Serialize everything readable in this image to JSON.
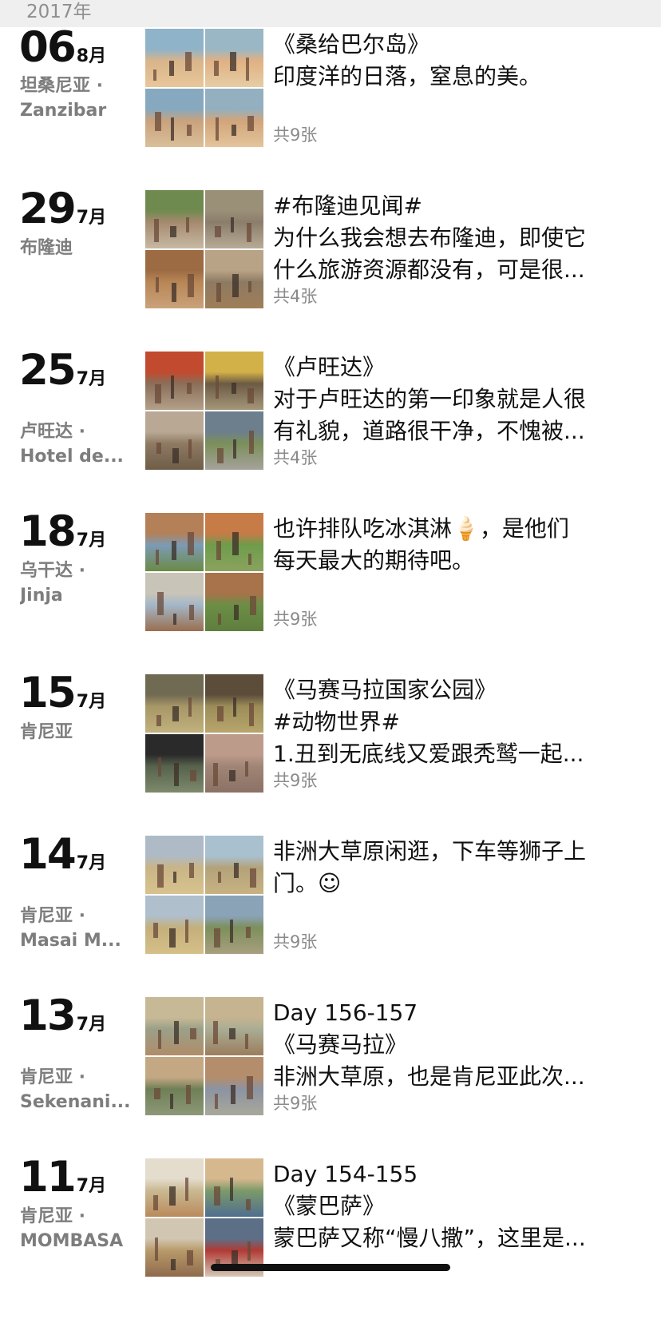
{
  "year_header": "2017年",
  "photo_count_label": "共{n}张",
  "entries": [
    {
      "day": "06",
      "month": "8月",
      "location": [
        "坦桑尼亚 ·",
        "Zanzibar"
      ],
      "lines": [
        "《桑给巴尔岛》",
        "印度洋的日落，窒息的美。"
      ],
      "count": "共9张"
    },
    {
      "day": "29",
      "month": "7月",
      "location": [
        "布隆迪"
      ],
      "lines": [
        "#布隆迪见闻#",
        "为什么我会想去布隆迪，即使它",
        "什么旅游资源都没有，可是很..."
      ],
      "count": "共4张"
    },
    {
      "day": "25",
      "month": "7月",
      "location": [
        "卢旺达 ·",
        "Hotel de..."
      ],
      "lines": [
        "《卢旺达》",
        "对于卢旺达的第一印象就是人很",
        "有礼貌，道路很干净，不愧被..."
      ],
      "count": "共4张"
    },
    {
      "day": "18",
      "month": "7月",
      "location": [
        "乌干达 ·",
        "Jinja"
      ],
      "lines": [
        "也许排队吃冰淇淋🍦，是他们",
        "每天最大的期待吧。"
      ],
      "count": "共9张"
    },
    {
      "day": "15",
      "month": "7月",
      "location": [
        "肯尼亚"
      ],
      "lines": [
        "《马赛马拉国家公园》",
        "#动物世界#",
        "1.丑到无底线又爱跟秃鹫一起..."
      ],
      "count": "共9张"
    },
    {
      "day": "14",
      "month": "7月",
      "location": [
        "肯尼亚 ·",
        "Masai M..."
      ],
      "lines": [
        "非洲大草原闲逛，下车等狮子上",
        "门。☺"
      ],
      "count": "共9张"
    },
    {
      "day": "13",
      "month": "7月",
      "location": [
        "肯尼亚 ·",
        "Sekenani..."
      ],
      "lines": [
        "Day 156-157",
        "《马赛马拉》",
        "非洲大草原，也是肯尼亚此次..."
      ],
      "count": "共9张"
    },
    {
      "day": "11",
      "month": "7月",
      "location": [
        "肯尼亚 ·",
        "MOMBASA"
      ],
      "lines": [
        "Day 154-155",
        "《蒙巴萨》",
        "蒙巴萨又称“慢八撒”，这里是..."
      ],
      "count": ""
    }
  ],
  "thumb_palettes": [
    [
      [
        "#d9b48a",
        "#8fb3c9",
        "#e8c79a"
      ],
      [
        "#e0b183",
        "#9ab7c6",
        "#e6cda4"
      ],
      [
        "#c9a27d",
        "#86a9bf",
        "#d9bf98"
      ],
      [
        "#d2a57a",
        "#94b0c0",
        "#e3c49c"
      ]
    ],
    [
      [
        "#a58a6e",
        "#6f8a4f",
        "#c7b9a3"
      ],
      [
        "#8b7d6b",
        "#9a9078",
        "#b7ab95"
      ],
      [
        "#b88656",
        "#9c6b43",
        "#caa27a"
      ],
      [
        "#8d7a62",
        "#b9a386",
        "#a07e58"
      ]
    ],
    [
      [
        "#8a6e58",
        "#c24a2e",
        "#b3a089"
      ],
      [
        "#6c5b44",
        "#d2b148",
        "#a59679"
      ],
      [
        "#8e7a63",
        "#b9a994",
        "#6f5d48"
      ],
      [
        "#7b8f5a",
        "#6d7f8c",
        "#a5a29b"
      ]
    ],
    [
      [
        "#7c9bb5",
        "#b38057",
        "#6b8a46"
      ],
      [
        "#6e9c4b",
        "#c77b47",
        "#8aa35e"
      ],
      [
        "#a3b7c9",
        "#c9c4b8",
        "#9a6e4e"
      ],
      [
        "#6c8e45",
        "#a8724a",
        "#5f7e3e"
      ]
    ],
    [
      [
        "#a79767",
        "#716a52",
        "#c1b17e"
      ],
      [
        "#9c8d58",
        "#5c4d3b",
        "#b7a56c"
      ],
      [
        "#56624c",
        "#2a2a2a",
        "#7d8a6c"
      ],
      [
        "#a08576",
        "#bd9b8b",
        "#8b7264"
      ]
    ],
    [
      [
        "#c9b486",
        "#aebbc6",
        "#d8c38f"
      ],
      [
        "#b3a27a",
        "#a9c0cf",
        "#c8b282"
      ],
      [
        "#c4af7b",
        "#b0bfcc",
        "#d5c089"
      ],
      [
        "#7d8f5b",
        "#8aa3b7",
        "#a89f7f"
      ]
    ],
    [
      [
        "#9aa088",
        "#c7b996",
        "#b08d69"
      ],
      [
        "#a9ad94",
        "#c5b48f",
        "#9b7d5d"
      ],
      [
        "#6f7f56",
        "#c3a883",
        "#8d9878"
      ],
      [
        "#8c93a2",
        "#b48d6c",
        "#a8a89a"
      ]
    ],
    [
      [
        "#c9b992",
        "#e4dccd",
        "#ba8a5c"
      ],
      [
        "#7d9a69",
        "#d6b88f",
        "#4f6e8f"
      ],
      [
        "#b89a6b",
        "#d1c6b1",
        "#8f6b4c"
      ],
      [
        "#b23a34",
        "#5d6f86",
        "#d4c8b7"
      ]
    ]
  ],
  "colors": {
    "year_bar_bg": "#efefef",
    "year_text": "#8e8e8e",
    "date_text": "#111111",
    "location_text": "#7d7d7d",
    "count_text": "#8a8a8a"
  }
}
